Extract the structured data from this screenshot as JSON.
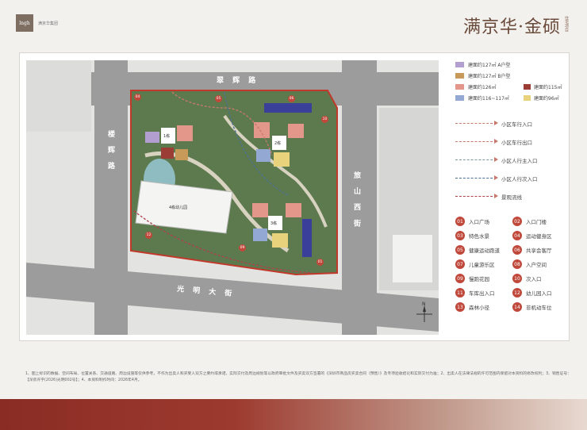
{
  "header": {
    "logo_mark": "lngh",
    "logo_sub": "满京华集团",
    "brand_name": "满京华·金硕",
    "brand_tag": "住宅项目"
  },
  "legend": {
    "unit_types": [
      {
        "label": "建面约127㎡ A户型",
        "color": "#b39fcf"
      },
      {
        "label": "建面约127㎡ B户型",
        "color": "#c79a5a"
      },
      {
        "label": "建面约126㎡",
        "color": "#e2978a"
      },
      {
        "label": "建面约115㎡",
        "color": "#9c3d35"
      },
      {
        "label": "建面约116~117㎡",
        "color": "#94a8d4"
      },
      {
        "label": "建面约96㎡",
        "color": "#e9d27c"
      }
    ],
    "routes": [
      {
        "label": "小区车行入口",
        "color": "#c9786c"
      },
      {
        "label": "小区车行出口",
        "color": "#c9786c"
      },
      {
        "label": "小区人行主入口",
        "color": "#7a9a9a"
      },
      {
        "label": "小区人行次入口",
        "color": "#4b6f95"
      },
      {
        "label": "景观流线",
        "color": "#b0404a"
      }
    ],
    "pois": [
      {
        "num": "01",
        "label": "入口广场"
      },
      {
        "num": "02",
        "label": "入口门楼"
      },
      {
        "num": "03",
        "label": "特色水景"
      },
      {
        "num": "04",
        "label": "运动健身区"
      },
      {
        "num": "05",
        "label": "健康运动跑道"
      },
      {
        "num": "06",
        "label": "共享会客厅"
      },
      {
        "num": "07",
        "label": "儿童游乐区"
      },
      {
        "num": "08",
        "label": "入户空间"
      },
      {
        "num": "09",
        "label": "慢跑花园"
      },
      {
        "num": "10",
        "label": "次入口"
      },
      {
        "num": "11",
        "label": "车库出入口"
      },
      {
        "num": "12",
        "label": "幼儿园入口"
      },
      {
        "num": "13",
        "label": "森林小径"
      },
      {
        "num": "14",
        "label": "非机动车位"
      }
    ]
  },
  "map": {
    "roads": {
      "north": "翠 辉 路",
      "west": "楼 辉 路",
      "east": "旅 山 西 街",
      "south": "光 明 大 街"
    },
    "buildings": {
      "kindergarten": "4栋幼儿园",
      "b1": "1栋",
      "b2": "2栋",
      "b3": "3栋",
      "compass": "N"
    }
  },
  "disclaimer": {
    "line1": "1、图上标识的数据、空间布局、位置关系、交通道路、周边设施等仅供参考，不作为出卖人和买受人双方之要约或承诺，实际交付及周边规划等以政府审批文件及买卖双方签署的《深圳市商品房买卖合同（预售）》及专项验收结论和实际交付为准；2、出卖人在法律法规的许可范围内保留对本资料的修改权利；3、销售证号：【深房许字(2026)光明002号】；4、本资料制作时间：2026年4月。"
  }
}
